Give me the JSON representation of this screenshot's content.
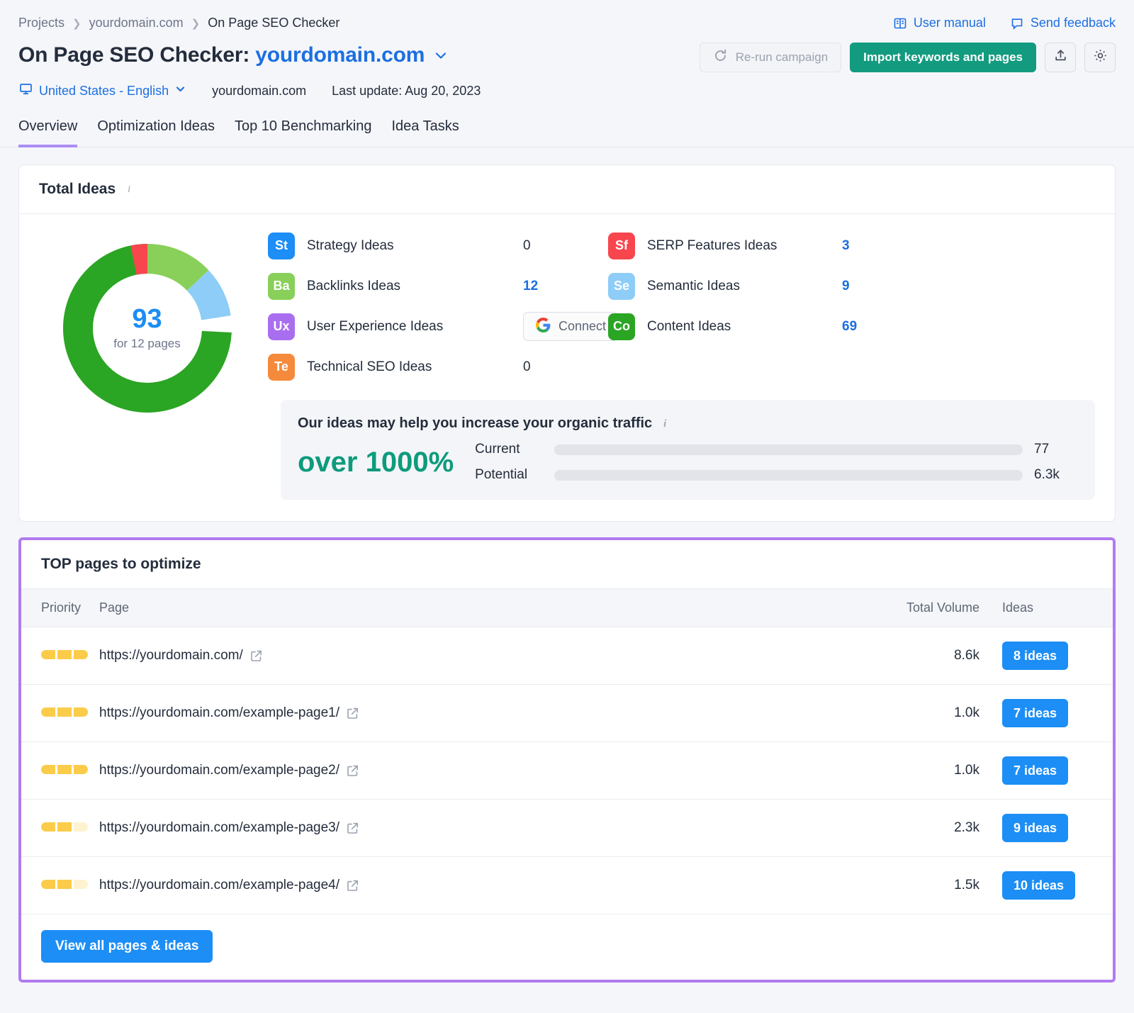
{
  "breadcrumb": {
    "items": [
      "Projects",
      "yourdomain.com",
      "On Page SEO Checker"
    ]
  },
  "helpers": {
    "user_manual": "User manual",
    "send_feedback": "Send feedback"
  },
  "header": {
    "title_prefix": "On Page SEO Checker:",
    "title_domain": "yourdomain.com",
    "rerun_label": "Re-run campaign",
    "import_label": "Import keywords and pages",
    "locale": "United States - English",
    "domain": "yourdomain.com",
    "last_update": "Last update: Aug 20, 2023"
  },
  "tabs": [
    {
      "label": "Overview",
      "active": true
    },
    {
      "label": "Optimization Ideas",
      "active": false
    },
    {
      "label": "Top 10 Benchmarking",
      "active": false
    },
    {
      "label": "Idea Tasks",
      "active": false
    }
  ],
  "total_ideas": {
    "card_title": "Total Ideas",
    "donut_total": "93",
    "donut_sub": "for 12 pages",
    "left_items": [
      {
        "badge": "St",
        "label": "Strategy Ideas",
        "value": "0",
        "color": "#1c8ef5",
        "is_zero": true
      },
      {
        "badge": "Ba",
        "label": "Backlinks Ideas",
        "value": "12",
        "color": "#88d05a",
        "is_zero": false
      },
      {
        "badge": "Ux",
        "label": "User Experience Ideas",
        "value": "",
        "color": "#a96ef0",
        "is_zero": false,
        "connect": "Connect"
      },
      {
        "badge": "Te",
        "label": "Technical SEO Ideas",
        "value": "0",
        "color": "#f58a3c",
        "is_zero": true
      }
    ],
    "right_items": [
      {
        "badge": "Sf",
        "label": "SERP Features Ideas",
        "value": "3",
        "color": "#f8464f",
        "is_zero": false
      },
      {
        "badge": "Se",
        "label": "Semantic Ideas",
        "value": "9",
        "color": "#8dcdf7",
        "is_zero": false
      },
      {
        "badge": "Co",
        "label": "Content Ideas",
        "value": "69",
        "color": "#2ba524",
        "is_zero": false
      }
    ]
  },
  "traffic": {
    "heading": "Our ideas may help you increase your organic traffic",
    "big_percent": "over 1000%",
    "current_label": "Current",
    "current_value": "77",
    "potential_label": "Potential",
    "potential_value": "6.3k",
    "current_pct": 1.2,
    "potential_pct": 100
  },
  "top_pages": {
    "title": "TOP pages to optimize",
    "columns": {
      "priority": "Priority",
      "page": "Page",
      "volume": "Total Volume",
      "ideas": "Ideas"
    },
    "rows": [
      {
        "priority": 3,
        "url": "https://yourdomain.com/",
        "volume": "8.6k",
        "ideas": "8 ideas"
      },
      {
        "priority": 3,
        "url": "https://yourdomain.com/example-page1/",
        "volume": "1.0k",
        "ideas": "7 ideas"
      },
      {
        "priority": 3,
        "url": "https://yourdomain.com/example-page2/",
        "volume": "1.0k",
        "ideas": "7 ideas"
      },
      {
        "priority": 2,
        "url": "https://yourdomain.com/example-page3/",
        "volume": "2.3k",
        "ideas": "9 ideas"
      },
      {
        "priority": 2,
        "url": "https://yourdomain.com/example-page4/",
        "volume": "1.5k",
        "ideas": "10 ideas"
      }
    ],
    "view_all": "View all pages & ideas"
  },
  "chart_data": {
    "type": "pie",
    "title": "Total Ideas",
    "categories": [
      "Content Ideas",
      "Backlinks Ideas",
      "Semantic Ideas",
      "SERP Features Ideas",
      "Strategy Ideas",
      "User Experience Ideas",
      "Technical SEO Ideas"
    ],
    "values": [
      69,
      12,
      9,
      3,
      0,
      0,
      0
    ],
    "colors": [
      "#2ba524",
      "#88d05a",
      "#8dcdf7",
      "#f8464f",
      "#1c8ef5",
      "#a96ef0",
      "#f58a3c"
    ],
    "total": 93,
    "center_label": "93",
    "center_sublabel": "for 12 pages",
    "legend": "right"
  }
}
